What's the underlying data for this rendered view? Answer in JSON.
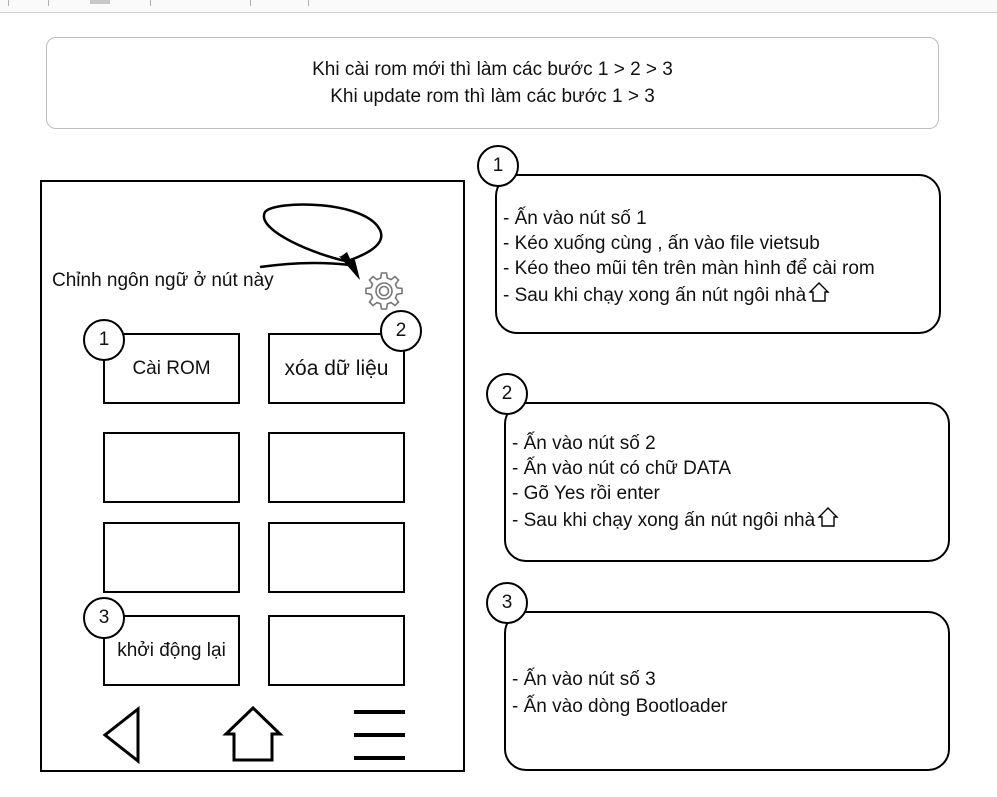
{
  "note": {
    "line1": "Khi cài rom mới thì làm các bước 1 > 2 > 3",
    "line2": "Khi update rom thì làm các bước 1 > 3"
  },
  "phone": {
    "language_label": "Chỉnh ngôn ngữ ở nút này",
    "buttons": {
      "install_rom": "Cài ROM",
      "wipe_data": "xóa dữ liệu",
      "reboot": "khởi động lại"
    },
    "badges": {
      "b1": "1",
      "b2": "2",
      "b3": "3"
    }
  },
  "steps": [
    {
      "number": "1",
      "lines": [
        "- Ấn vào nút số 1",
        "- Kéo xuống cùng , ấn vào file vietsub",
        "- Kéo theo mũi tên trên màn hình để cài rom",
        "- Sau khi chạy xong ấn nút ngôi nhà"
      ]
    },
    {
      "number": "2",
      "lines": [
        "- Ấn vào nút số 2",
        "- Ấn vào nút có chữ DATA",
        "- Gõ Yes rồi enter",
        "- Sau khi chạy xong ấn nút ngôi nhà"
      ]
    },
    {
      "number": "3",
      "lines": [
        "- Ấn vào nút số 3",
        "- Ấn vào dòng Bootloader"
      ]
    }
  ],
  "icons": {
    "gear": "gear-icon",
    "home": "home-icon",
    "back": "back-icon",
    "menu": "menu-icon"
  },
  "colors": {
    "stroke": "#000000",
    "gear": "#777777",
    "note_border": "#bdbdbd"
  }
}
